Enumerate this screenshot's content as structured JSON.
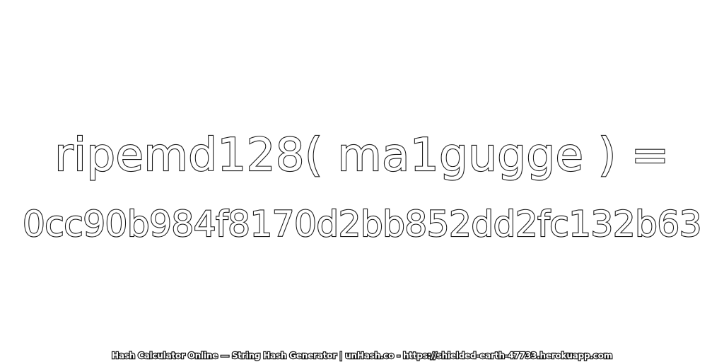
{
  "expression": "ripemd128( ma1gugge ) =",
  "hash": "0cc90b984f8170d2bb852dd2fc132b63",
  "footer": "Hash Calculator Online — String Hash Generator | unHash.co - https://shielded-earth-47733.herokuapp.com",
  "colors": {
    "background": "#ffffff",
    "text_fill": "#ffffff",
    "text_outline": "#1a1a1a"
  }
}
